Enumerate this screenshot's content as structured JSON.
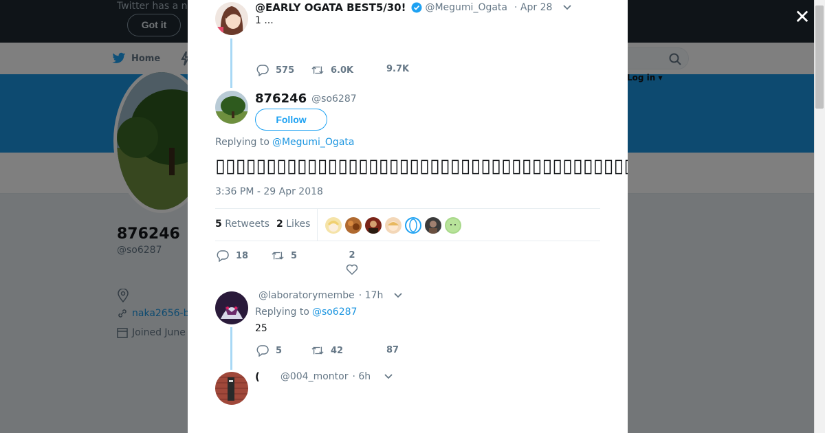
{
  "background": {
    "banner_text": "Twitter has a n",
    "got_it": "Got it",
    "nav_home": "Home",
    "login": "Log in ▾",
    "profile_name": "876246",
    "profile_handle": "@so6287",
    "profile_link": "naka2656-b",
    "profile_joined": "Joined June"
  },
  "modal": {
    "parent": {
      "name": "@EARLY OGATA BEST5/30!",
      "handle": "@Megumi_Ogata",
      "time": "· Apr 28",
      "text": "1 ...",
      "replies": "575",
      "retweets": "6.0K",
      "likes": "9.7K"
    },
    "main": {
      "name": "876246",
      "handle": "@so6287",
      "follow": "Follow",
      "replying_prefix": "Replying to",
      "replying_to": "@Megumi_Ogata",
      "text": "▯▯▯▯▯▯▯▯▯▯▯▯▯▯▯▯▯▯▯▯▯▯▯▯▯▯▯▯▯▯▯▯▯▯▯▯▯▯▯▯▯▯▯▯▯▯▯▯▯▯▯▯",
      "timestamp": "3:36 PM - 29 Apr 2018",
      "retweets_count": "5",
      "retweets_label": "Retweets",
      "likes_count": "2",
      "likes_label": "Likes",
      "replies": "18",
      "retweets": "5",
      "likes": "2"
    },
    "reply1": {
      "name": "",
      "handle": "@laboratorymembe",
      "time": "· 17h",
      "replying_prefix": "Replying to",
      "replying_to": "@so6287",
      "text": "25",
      "replies": "5",
      "retweets": "42",
      "likes": "87"
    },
    "reply2": {
      "name": "(",
      "handle": "@004_montor",
      "time": "· 6h"
    }
  },
  "colors": {
    "accent": "#1da1f2",
    "link": "#1b95e0",
    "cover": "#1b95e0",
    "thread": "#a8d8f5"
  }
}
